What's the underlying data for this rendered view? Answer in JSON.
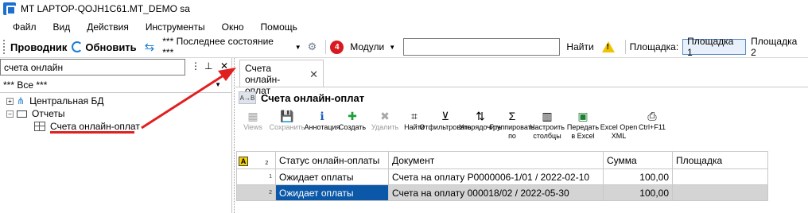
{
  "window": {
    "title": "MT LAPTOP-QOJH1C61.MT_DEMO sa"
  },
  "menu": [
    "Файл",
    "Вид",
    "Действия",
    "Инструменты",
    "Окно",
    "Помощь"
  ],
  "toolbar": {
    "explorer_label": "Проводник",
    "refresh_label": "Обновить",
    "state_label": "*** Последнее состояние ***",
    "notifications_count": "4",
    "modules_label": "Модули",
    "search_value": "",
    "find_label": "Найти",
    "site_label": "Площадка:",
    "site1": "Площадка 1",
    "site2": "Площадка 2"
  },
  "left_panel": {
    "search_value": "счета онлайн",
    "filter_value": "*** Все ***",
    "tree": {
      "central_db": "Центральная БД",
      "reports": "Отчеты",
      "online_invoices": "Счета онлайн-оплат"
    }
  },
  "document": {
    "tab_label": "Счета онлайн-оплат",
    "title": "Счета онлайн-оплат",
    "ribbon": [
      {
        "name": "views",
        "icon": "views-icon",
        "label": "Views",
        "enabled": false
      },
      {
        "name": "save",
        "icon": "save-icon",
        "label": "Сохранить",
        "enabled": false
      },
      {
        "name": "annotation",
        "icon": "info-icon",
        "label": "Аннотация",
        "enabled": true
      },
      {
        "name": "create",
        "icon": "plus-icon",
        "label": "Создать",
        "enabled": true
      },
      {
        "name": "delete",
        "icon": "delete-icon",
        "label": "Удалить",
        "enabled": false
      },
      {
        "name": "find",
        "icon": "binoculars-icon",
        "label": "Найти",
        "enabled": true
      },
      {
        "name": "filter",
        "icon": "filter-icon",
        "label": "Отфильтровать",
        "enabled": true
      },
      {
        "name": "sort",
        "icon": "sort-icon",
        "label": "Упорядочить",
        "enabled": true
      },
      {
        "name": "group",
        "icon": "sigma-icon",
        "label": "Группировать по",
        "enabled": true
      },
      {
        "name": "columns",
        "icon": "columns-icon",
        "label": "Настроить столбцы",
        "enabled": true
      },
      {
        "name": "excel",
        "icon": "excel-icon",
        "label": "Передать в Excel",
        "enabled": true
      },
      {
        "name": "excel-xml",
        "icon": "excel-xml-icon",
        "label": "Excel Open XML",
        "enabled": true
      },
      {
        "name": "print",
        "icon": "printer-icon",
        "label": "Ctrl+F11",
        "enabled": true
      }
    ],
    "grid": {
      "corner_label": "A",
      "header_rownum": "2",
      "columns": [
        "Статус онлайн-оплаты",
        "Документ",
        "Сумма",
        "Площадка"
      ],
      "rows": [
        {
          "num": "1",
          "status": "Ожидает оплаты",
          "document": "Счета на оплату P0000006-1/01 / 2022-02-10",
          "sum": "100,00",
          "site": ""
        },
        {
          "num": "2",
          "status": "Ожидает оплаты",
          "document": "Счета на оплату 000018/02 / 2022-05-30",
          "sum": "100,00",
          "site": ""
        }
      ]
    }
  },
  "colors": {
    "accent": "#0b58a8",
    "annotation_arrow": "#e02020",
    "badge": "#d71920"
  }
}
